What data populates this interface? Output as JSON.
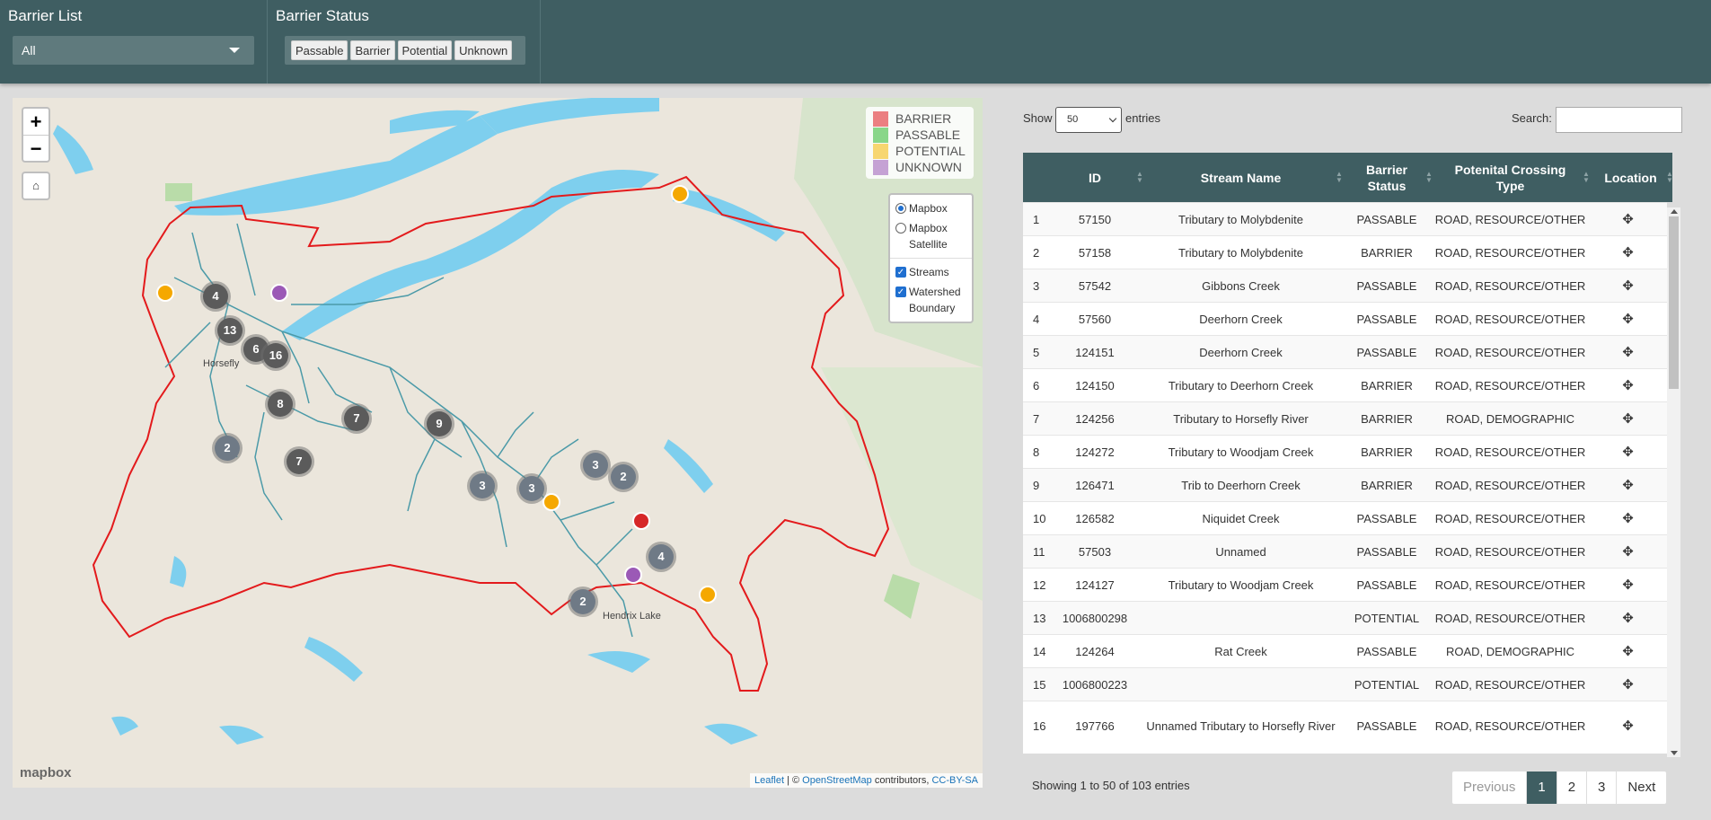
{
  "header": {
    "barrier_list_label": "Barrier List",
    "barrier_list_value": "All",
    "barrier_status_label": "Barrier Status",
    "status_buttons": [
      "Passable",
      "Barrier",
      "Potential",
      "Unknown"
    ]
  },
  "map": {
    "legend": [
      {
        "label": "BARRIER",
        "color": "#e0191f"
      },
      {
        "label": "PASSABLE",
        "color": "#2eb82e"
      },
      {
        "label": "POTENTIAL",
        "color": "#f5b800"
      },
      {
        "label": "UNKNOWN",
        "color": "#9b59b6"
      }
    ],
    "zoom_in": "+",
    "zoom_out": "−",
    "home_icon": "home-icon",
    "layers": {
      "base_mapbox": "Mapbox",
      "base_satellite": "Mapbox Satellite",
      "overlay_streams": "Streams",
      "overlay_watershed": "Watershed Boundary"
    },
    "clusters": [
      "4",
      "13",
      "6",
      "16",
      "8",
      "7",
      "9",
      "2",
      "7",
      "3",
      "3",
      "3",
      "2",
      "4",
      "2"
    ],
    "places": [
      "Horsefly",
      "Hendrix Lake"
    ],
    "mapbox_logo": "mapbox",
    "attribution": {
      "leaflet": "Leaflet",
      "sep": " | © ",
      "osm": "OpenStreetMap",
      "contrib": " contributors, ",
      "license": "CC-BY-SA"
    }
  },
  "table": {
    "show_label": "Show",
    "page_length": "50",
    "entries_label": "entries",
    "search_label": "Search:",
    "columns": [
      "",
      "ID",
      "Stream Name",
      "Barrier Status",
      "Potenital Crossing Type",
      "Location"
    ],
    "rows": [
      {
        "n": "1",
        "id": "57150",
        "name": "Tributary to Molybdenite",
        "status": "PASSABLE",
        "type": "ROAD, RESOURCE/OTHER"
      },
      {
        "n": "2",
        "id": "57158",
        "name": "Tributary to Molybdenite",
        "status": "BARRIER",
        "type": "ROAD, RESOURCE/OTHER"
      },
      {
        "n": "3",
        "id": "57542",
        "name": "Gibbons Creek",
        "status": "PASSABLE",
        "type": "ROAD, RESOURCE/OTHER"
      },
      {
        "n": "4",
        "id": "57560",
        "name": "Deerhorn Creek",
        "status": "PASSABLE",
        "type": "ROAD, RESOURCE/OTHER"
      },
      {
        "n": "5",
        "id": "124151",
        "name": "Deerhorn Creek",
        "status": "PASSABLE",
        "type": "ROAD, RESOURCE/OTHER"
      },
      {
        "n": "6",
        "id": "124150",
        "name": "Tributary to Deerhorn Creek",
        "status": "BARRIER",
        "type": "ROAD, RESOURCE/OTHER"
      },
      {
        "n": "7",
        "id": "124256",
        "name": "Tributary to Horsefly River",
        "status": "BARRIER",
        "type": "ROAD, DEMOGRAPHIC"
      },
      {
        "n": "8",
        "id": "124272",
        "name": "Tributary to Woodjam Creek",
        "status": "BARRIER",
        "type": "ROAD, RESOURCE/OTHER"
      },
      {
        "n": "9",
        "id": "126471",
        "name": "Trib to Deerhorn Creek",
        "status": "BARRIER",
        "type": "ROAD, RESOURCE/OTHER"
      },
      {
        "n": "10",
        "id": "126582",
        "name": "Niquidet Creek",
        "status": "PASSABLE",
        "type": "ROAD, RESOURCE/OTHER"
      },
      {
        "n": "11",
        "id": "57503",
        "name": "Unnamed",
        "status": "PASSABLE",
        "type": "ROAD, RESOURCE/OTHER"
      },
      {
        "n": "12",
        "id": "124127",
        "name": "Tributary to Woodjam Creek",
        "status": "PASSABLE",
        "type": "ROAD, RESOURCE/OTHER"
      },
      {
        "n": "13",
        "id": "1006800298",
        "name": "",
        "status": "POTENTIAL",
        "type": "ROAD, RESOURCE/OTHER"
      },
      {
        "n": "14",
        "id": "124264",
        "name": "Rat Creek",
        "status": "PASSABLE",
        "type": "ROAD, DEMOGRAPHIC"
      },
      {
        "n": "15",
        "id": "1006800223",
        "name": "",
        "status": "POTENTIAL",
        "type": "ROAD, RESOURCE/OTHER"
      },
      {
        "n": "16",
        "id": "197766",
        "name": "Unnamed Tributary to Horsefly River",
        "status": "PASSABLE",
        "type": "ROAD, RESOURCE/OTHER"
      }
    ],
    "location_icon": "move-icon",
    "info": "Showing 1 to 50 of 103 entries",
    "pagination": [
      "Previous",
      "1",
      "2",
      "3",
      "Next"
    ]
  }
}
